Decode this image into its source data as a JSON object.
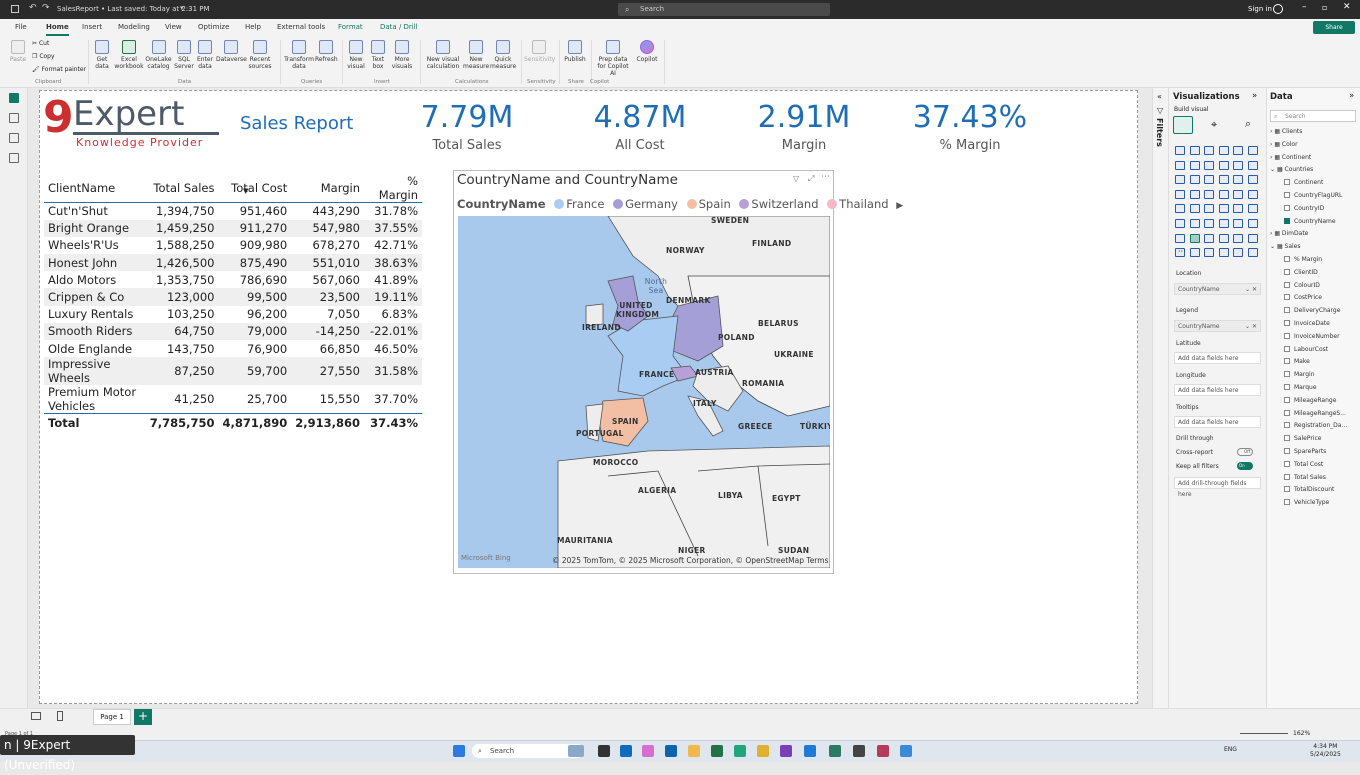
{
  "window": {
    "title": "SalesReport • Last saved: Today at 2:31 PM",
    "search_placeholder": "Search",
    "sign_in": "Sign in"
  },
  "menu": [
    "File",
    "Home",
    "Insert",
    "Modeling",
    "View",
    "Optimize",
    "Help",
    "External tools",
    "Format",
    "Data / Drill"
  ],
  "share_label": "Share",
  "ribbon": {
    "paste": "Paste",
    "cut": "Cut",
    "copy": "Copy",
    "format_painter": "Format painter",
    "buttons": [
      "Get data",
      "Excel workbook",
      "OneLake catalog",
      "SQL Server",
      "Enter data",
      "Dataverse",
      "Recent sources",
      "Transform data",
      "Refresh",
      "New visual",
      "Text box",
      "More visuals",
      "New visual calculation",
      "New measure",
      "Quick measure",
      "Sensitivity",
      "Publish",
      "Prep data for Copilot AI",
      "Copilot"
    ],
    "groups": [
      "Clipboard",
      "Data",
      "Queries",
      "Insert",
      "Calculations",
      "Sensitivity",
      "Share",
      "Copilot"
    ]
  },
  "report": {
    "logo_nine": "9",
    "logo_text": "Expert",
    "logo_sub": "Knowledge Provider",
    "title": "Sales Report",
    "kpis": [
      {
        "value": "7.79M",
        "label": "Total Sales"
      },
      {
        "value": "4.87M",
        "label": "All Cost"
      },
      {
        "value": "2.91M",
        "label": "Margin"
      },
      {
        "value": "37.43%",
        "label": "% Margin"
      }
    ],
    "table": {
      "headers": [
        "ClientName",
        "Total Sales",
        "Total Cost",
        "Margin",
        "% Margin"
      ],
      "rows": [
        [
          "Cut'n'Shut",
          "1,394,750",
          "951,460",
          "443,290",
          "31.78%"
        ],
        [
          "Bright Orange",
          "1,459,250",
          "911,270",
          "547,980",
          "37.55%"
        ],
        [
          "Wheels'R'Us",
          "1,588,250",
          "909,980",
          "678,270",
          "42.71%"
        ],
        [
          "Honest John",
          "1,426,500",
          "875,490",
          "551,010",
          "38.63%"
        ],
        [
          "Aldo Motors",
          "1,353,750",
          "786,690",
          "567,060",
          "41.89%"
        ],
        [
          "Crippen & Co",
          "123,000",
          "99,500",
          "23,500",
          "19.11%"
        ],
        [
          "Luxury Rentals",
          "103,250",
          "96,200",
          "7,050",
          "6.83%"
        ],
        [
          "Smooth Riders",
          "64,750",
          "79,000",
          "-14,250",
          "-22.01%"
        ],
        [
          "Olde Englande",
          "143,750",
          "76,900",
          "66,850",
          "46.50%"
        ],
        [
          "Impressive Wheels",
          "87,250",
          "59,700",
          "27,550",
          "31.58%"
        ],
        [
          "Premium Motor Vehicles",
          "41,250",
          "25,700",
          "15,550",
          "37.70%"
        ]
      ],
      "total": [
        "Total",
        "7,785,750",
        "4,871,890",
        "2,913,860",
        "37.43%"
      ]
    },
    "map": {
      "title": "CountryName and CountryName",
      "legend_title": "CountryName",
      "legend": [
        {
          "name": "France",
          "color": "#a9cdf2"
        },
        {
          "name": "Germany",
          "color": "#a59fd8"
        },
        {
          "name": "Spain",
          "color": "#f3bfa4"
        },
        {
          "name": "Switzerland",
          "color": "#b79fd7"
        },
        {
          "name": "Thailand",
          "color": "#f5b8c4"
        }
      ],
      "labels": [
        "SWEDEN",
        "NORWAY",
        "FINLAND",
        "North Sea",
        "UNITED KINGDOM",
        "DENMARK",
        "IRELAND",
        "BELARUS",
        "POLAND",
        "UKRAINE",
        "FRANCE",
        "AUSTRIA",
        "ROMANIA",
        "ITALY",
        "SPAIN",
        "PORTUGAL",
        "GREECE",
        "TÜRKIY",
        "MOROCCO",
        "ALGERIA",
        "LIBYA",
        "EGYPT",
        "MAURITANIA",
        "NIGER",
        "SUDAN"
      ],
      "attribution": "© 2025 TomTom, © 2025 Microsoft Corporation, © OpenStreetMap  Terms",
      "bing": "Microsoft Bing"
    }
  },
  "visualizations": {
    "title": "Visualizations",
    "build_visual": "Build visual",
    "filters_label": "Filters",
    "wells": [
      {
        "label": "Location",
        "value": "CountryName"
      },
      {
        "label": "Legend",
        "value": "CountryName"
      },
      {
        "label": "Latitude",
        "value": "Add data fields here"
      },
      {
        "label": "Longitude",
        "value": "Add data fields here"
      },
      {
        "label": "Tooltips",
        "value": "Add data fields here"
      }
    ],
    "drill_through": "Drill through",
    "cross_report": "Cross-report",
    "cross_report_state": "Off",
    "keep_all_filters": "Keep all filters",
    "keep_all_state": "On",
    "drill_add": "Add drill-through fields here"
  },
  "data_pane": {
    "title": "Data",
    "search_placeholder": "Search",
    "tables": [
      "Clients",
      "Color",
      "Continent",
      "Countries"
    ],
    "country_fields": [
      "Continent",
      "CountryFlagURL",
      "CountryID",
      "CountryName"
    ],
    "tables2": [
      "DimDate",
      "Sales"
    ],
    "sales_fields": [
      "% Margin",
      "ClientID",
      "ColourID",
      "CostPrice",
      "DeliveryCharge",
      "InvoiceDate",
      "InvoiceNumber",
      "LabourCost",
      "Make",
      "Margin",
      "Marque",
      "MileageRange",
      "MileageRangeS...",
      "Registration_Da...",
      "SalePrice",
      "SpareParts",
      "Total Cost",
      "Total Sales",
      "TotalDiscount",
      "VehicleType"
    ]
  },
  "footer": {
    "page_tab": "Page 1",
    "add_page": "+",
    "page_count": "Page 1 of 1",
    "zoom": "162%",
    "unverified": "n | 9Expert (Unverified)"
  },
  "taskbar": {
    "search": "Search",
    "lang": "ENG",
    "time": "4:34 PM",
    "date": "5/24/2025"
  }
}
